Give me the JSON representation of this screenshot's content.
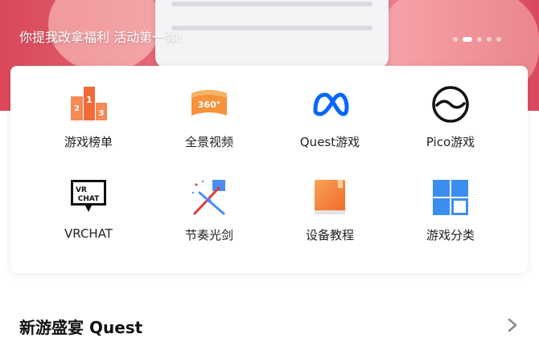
{
  "banner": {
    "caption": "你提我改拿福利 活动第一弹!",
    "dot_count": 5,
    "active_dot": 1
  },
  "grid": {
    "items": [
      {
        "label": "游戏榜单",
        "icon": "ranking-podium-icon"
      },
      {
        "label": "全景视频",
        "icon": "panorama-360-icon"
      },
      {
        "label": "Quest游戏",
        "icon": "meta-infinity-icon"
      },
      {
        "label": "Pico游戏",
        "icon": "pico-logo-icon"
      },
      {
        "label": "VRCHAT",
        "icon": "vrchat-logo-icon"
      },
      {
        "label": "节奏光剑",
        "icon": "beat-saber-icon"
      },
      {
        "label": "设备教程",
        "icon": "tutorial-book-icon"
      },
      {
        "label": "游戏分类",
        "icon": "windows-grid-icon"
      }
    ]
  },
  "section": {
    "title": "新游盛宴 Quest"
  },
  "colors": {
    "banner_pink": "#d9485a",
    "meta_blue": "#0866ff",
    "icon_orange": "#f26a3a",
    "category_blue": "#3b8ef0"
  }
}
